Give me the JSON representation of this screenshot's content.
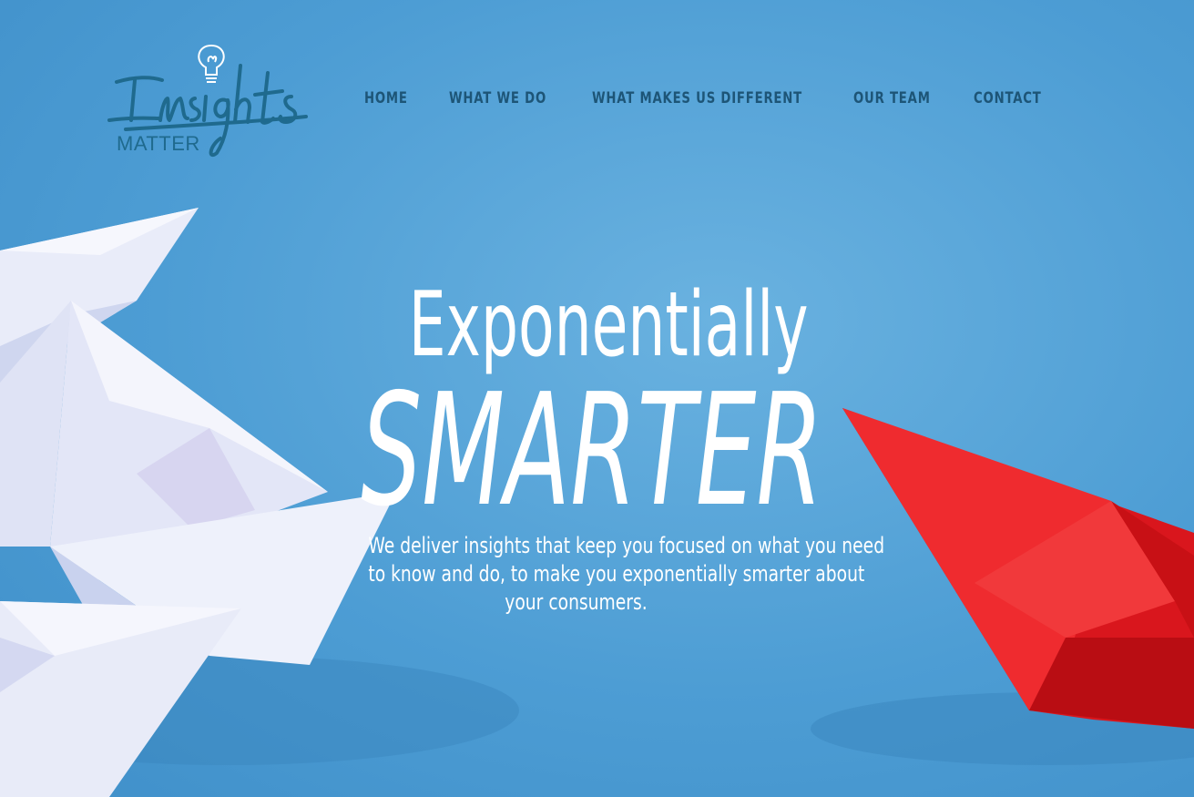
{
  "logo": {
    "script_text": "Insights",
    "sub_text": "MATTER",
    "icon": "lightbulb-icon"
  },
  "nav": {
    "items": [
      {
        "label": "HOME"
      },
      {
        "label": "WHAT WE DO"
      },
      {
        "label": "WHAT MAKES US DIFFERENT"
      },
      {
        "label": "OUR TEAM"
      },
      {
        "label": "CONTACT"
      }
    ]
  },
  "hero": {
    "headline_line1": "Exponentially",
    "headline_line2": "SMARTER",
    "tagline_lines": [
      "We deliver insights that keep you focused on what you need",
      "to know and do, to make you exponentially smarter about",
      "your consumers."
    ]
  },
  "colors": {
    "background": "#4d9dd4",
    "nav_text": "#1d5577",
    "logo": "#1f6a8e",
    "hero_text": "#ffffff",
    "red_boat": "#e8262b",
    "white_boat": "#eef0fb"
  }
}
